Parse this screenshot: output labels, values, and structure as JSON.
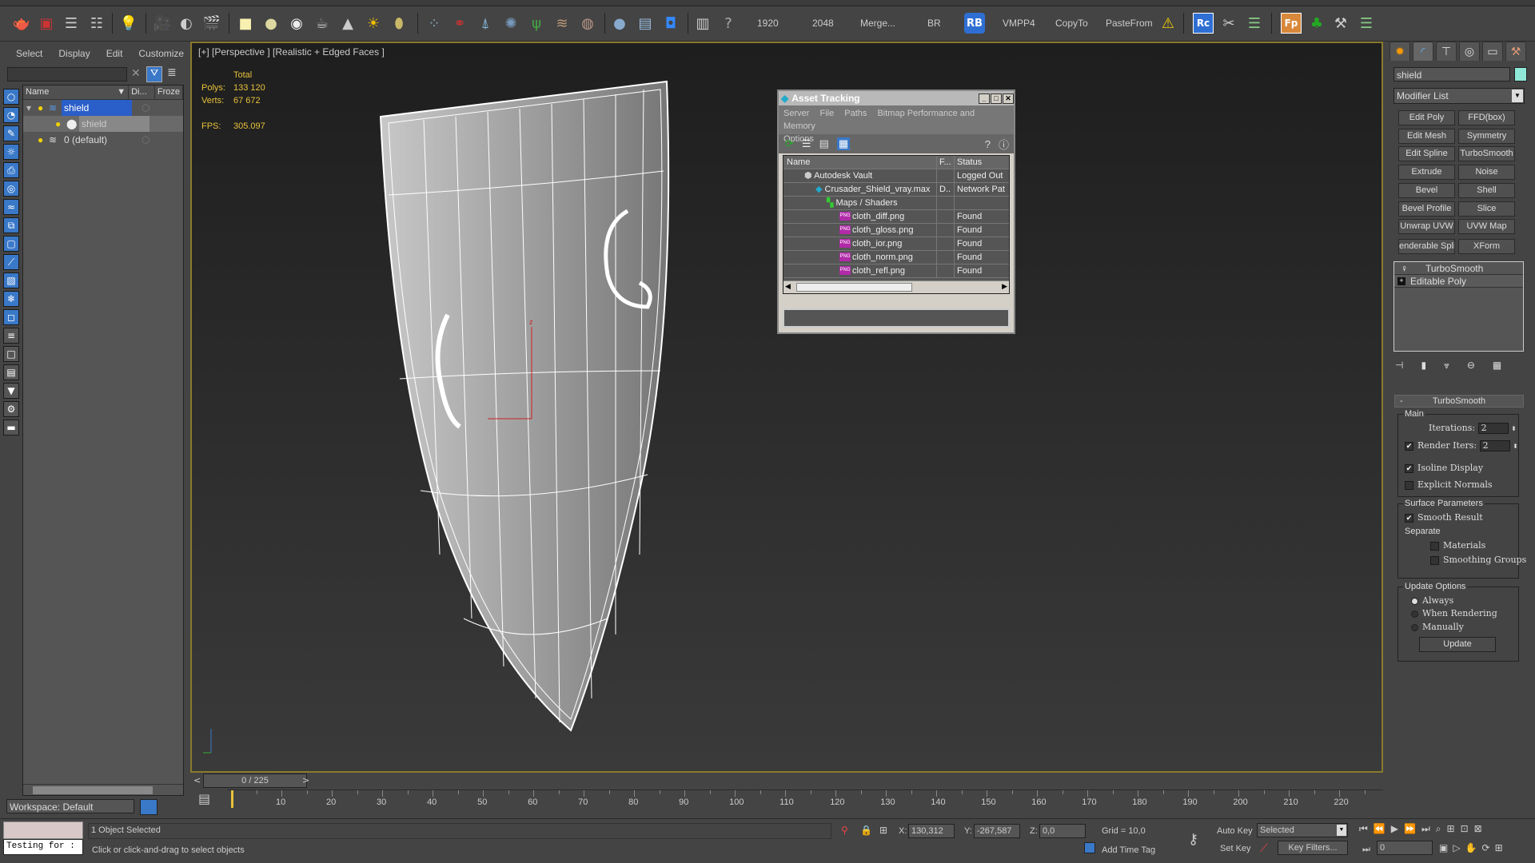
{
  "toolbar": {
    "text_buttons": [
      "1920",
      "2048",
      "Merge...",
      "BR",
      "VMPP4",
      "CopyTo",
      "PasteFrom"
    ],
    "rb_label": "RB",
    "rc_label": "Rc",
    "fp_label": "Fp",
    "icons": [
      "teapot-icon",
      "render-frame-icon",
      "render-setup-icon",
      "render-settings-icon",
      "light-lister-icon",
      "camera-icon",
      "camera-sequencer-icon",
      "multicam-icon",
      "box-light-icon",
      "dome-light-icon",
      "sphere-light-icon",
      "teapot-mesh-icon",
      "cone-light-icon",
      "sun-icon",
      "ies-light-icon",
      "particle-icon",
      "molecule-icon",
      "transmission-icon",
      "fur-ball-icon",
      "grass-icon",
      "hair-fur-icon",
      "ox-hair-icon",
      "sphere-material-icon",
      "material-browser-icon",
      "render-region-icon",
      "scene-converter-icon",
      "help-icon",
      "warning-icon",
      "tools-icon",
      "list-icon",
      "trees-icon"
    ]
  },
  "scene_explorer": {
    "menu": [
      "Select",
      "Display",
      "Edit",
      "Customize"
    ],
    "search_value": "",
    "columns": [
      "Name",
      "Di...",
      "Froze"
    ],
    "rows": [
      {
        "name": "shield",
        "level": 0,
        "type": "layer",
        "selected": true
      },
      {
        "name": "shield",
        "level": 1,
        "type": "object",
        "selected": false
      },
      {
        "name": "0 (default)",
        "level": 0,
        "type": "layer",
        "selected": false
      }
    ],
    "workspace_label": "Workspace: Default"
  },
  "viewport": {
    "label": "[+] [Perspective ] [Realistic + Edged Faces ]",
    "stats": {
      "total_label": "Total",
      "polys_label": "Polys:",
      "polys": "133 120",
      "verts_label": "Verts:",
      "verts": "67 672",
      "fps_label": "FPS:",
      "fps": "305.097"
    },
    "gizmo_axis_label": "z"
  },
  "asset_tracking": {
    "title": "Asset Tracking",
    "menu": [
      "Server",
      "File",
      "Paths",
      "Bitmap Performance and Memory",
      "Options"
    ],
    "columns": [
      "Name",
      "F...",
      "Status"
    ],
    "rows": [
      {
        "name": "Autodesk Vault",
        "f": "",
        "status": "Logged Out",
        "indent": 1,
        "icon": "vault"
      },
      {
        "name": "Crusader_Shield_vray.max",
        "f": "D..",
        "status": "Network Pat",
        "indent": 2,
        "icon": "max"
      },
      {
        "name": "Maps / Shaders",
        "f": "",
        "status": "",
        "indent": 3,
        "icon": "maps"
      },
      {
        "name": "cloth_diff.png",
        "f": "",
        "status": "Found",
        "indent": 4,
        "icon": "png"
      },
      {
        "name": "cloth_gloss.png",
        "f": "",
        "status": "Found",
        "indent": 4,
        "icon": "png"
      },
      {
        "name": "cloth_ior.png",
        "f": "",
        "status": "Found",
        "indent": 4,
        "icon": "png"
      },
      {
        "name": "cloth_norm.png",
        "f": "",
        "status": "Found",
        "indent": 4,
        "icon": "png"
      },
      {
        "name": "cloth_refl.png",
        "f": "",
        "status": "Found",
        "indent": 4,
        "icon": "png"
      }
    ]
  },
  "command_panel": {
    "object_name": "shield",
    "object_color": "#8fe8d8",
    "modifier_list_label": "Modifier List",
    "modifier_buttons": [
      "Edit Poly",
      "FFD(box)",
      "Edit Mesh",
      "Symmetry",
      "Edit Spline",
      "TurboSmooth",
      "Extrude",
      "Noise",
      "Bevel",
      "Shell",
      "Bevel Profile",
      "Slice",
      "Unwrap UVW",
      "UVW Map",
      "enderable Splir",
      "XForm"
    ],
    "stack": [
      "TurboSmooth",
      "Editable Poly"
    ],
    "rollout": {
      "title": "TurboSmooth",
      "collapse_glyph": "-",
      "main_label": "Main",
      "iterations_label": "Iterations:",
      "iterations": "2",
      "render_iters_label": "Render Iters:",
      "render_iters": "2",
      "render_iters_checked": true,
      "isoline_label": "Isoline Display",
      "isoline_checked": true,
      "explicit_normals_label": "Explicit Normals",
      "explicit_normals_checked": false,
      "surface_label": "Surface Parameters",
      "smooth_result_label": "Smooth Result",
      "smooth_result_checked": true,
      "separate_label": "Separate",
      "materials_label": "Materials",
      "smoothing_groups_label": "Smoothing Groups",
      "update_options_label": "Update Options",
      "update_options": [
        "Always",
        "When Rendering",
        "Manually"
      ],
      "update_selected": "Always",
      "update_button": "Update"
    }
  },
  "timeline": {
    "frame_display": "0 / 225",
    "ticks": [
      "10",
      "20",
      "30",
      "40",
      "50",
      "60",
      "70",
      "80",
      "90",
      "100",
      "110",
      "120",
      "130",
      "140",
      "150",
      "160",
      "170",
      "180",
      "190",
      "200",
      "210",
      "220"
    ],
    "current_frame": 0,
    "max_frame": 225
  },
  "status": {
    "maxscript_value": "Testing for :",
    "selection": "1 Object Selected",
    "prompt": "Click or click-and-drag to select objects",
    "x_label": "X:",
    "x_value": "130,312",
    "y_label": "Y:",
    "y_value": "-267,587",
    "z_label": "Z:",
    "z_value": "0,0",
    "grid": "Grid = 10,0",
    "add_time_tag": "Add Time Tag",
    "auto_key": "Auto Key",
    "set_key": "Set Key",
    "selected_option": "Selected",
    "key_filters": "Key Filters...",
    "frame_field": "0"
  }
}
